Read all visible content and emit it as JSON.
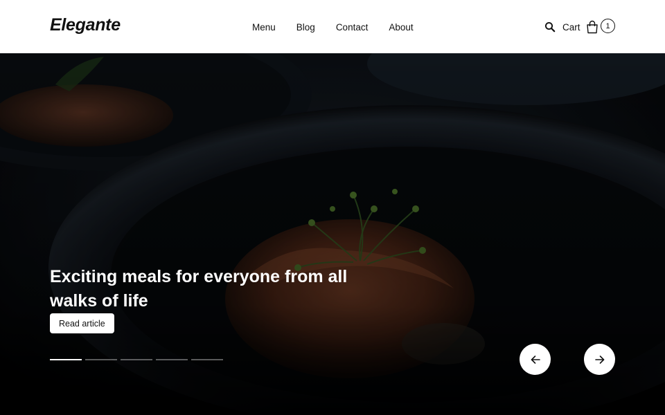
{
  "header": {
    "logo": "Elegante",
    "nav": [
      "Menu",
      "Blog",
      "Contact",
      "About"
    ],
    "cart_label": "Cart",
    "cart_count": "1"
  },
  "hero": {
    "headline": "Exciting meals for everyone from all walks of life",
    "cta_label": "Read article",
    "slide_count": 5,
    "active_slide": 1
  },
  "icons": {
    "search": "search-icon",
    "cart": "shopping-bag-icon",
    "prev": "arrow-left-icon",
    "next": "arrow-right-icon"
  },
  "colors": {
    "header_bg": "#ffffff",
    "text": "#111111",
    "hero_overlay": "#05070a",
    "button_bg": "#ffffff"
  }
}
